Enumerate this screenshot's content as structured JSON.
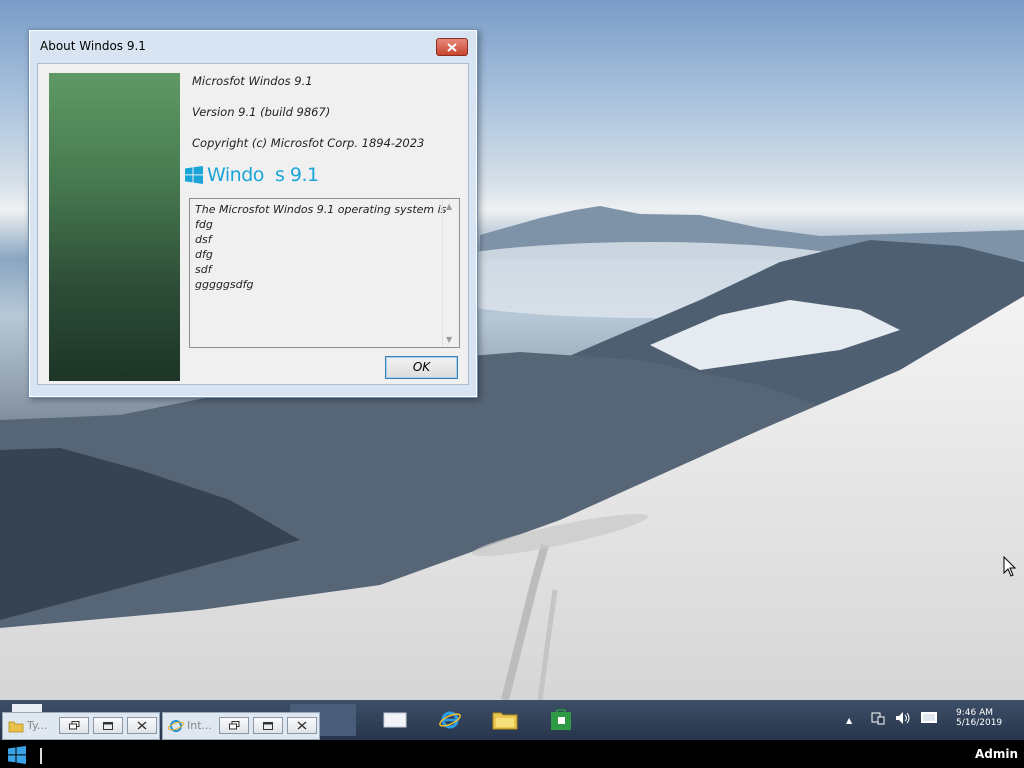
{
  "dialog": {
    "title": "About Windos 9.1",
    "product_name": "Microsfot Windos 9.1",
    "version": "Version 9.1 (build 9867)",
    "copyright": "Copyright (c) Microsfot Corp. 1894-2023",
    "logo_text": "Windo  s 9.1",
    "description_lines": [
      "The Microsfot Windos 9.1 operating system is",
      "fdg",
      "dsf",
      "dfg",
      "sdf",
      "gggggsdfg"
    ],
    "ok_label": "OK",
    "close_icon": "close-icon",
    "accent_color": "#1aa5d8"
  },
  "taskbar": {
    "windows": [
      {
        "label": "Ty...",
        "icon": "folder-icon"
      },
      {
        "label": "Int...",
        "icon": "internet-explorer-icon"
      }
    ],
    "pinned": [
      "window-icon",
      "internet-explorer-icon",
      "file-explorer-icon",
      "store-icon"
    ],
    "tray_icons": [
      "show-hidden-icon",
      "network-icon",
      "volume-icon",
      "action-center-icon"
    ],
    "clock_time": "9:46 AM",
    "clock_date": "5/16/2019"
  },
  "status_bar": {
    "user": "Admin",
    "start_icon": "windows-logo-icon"
  }
}
